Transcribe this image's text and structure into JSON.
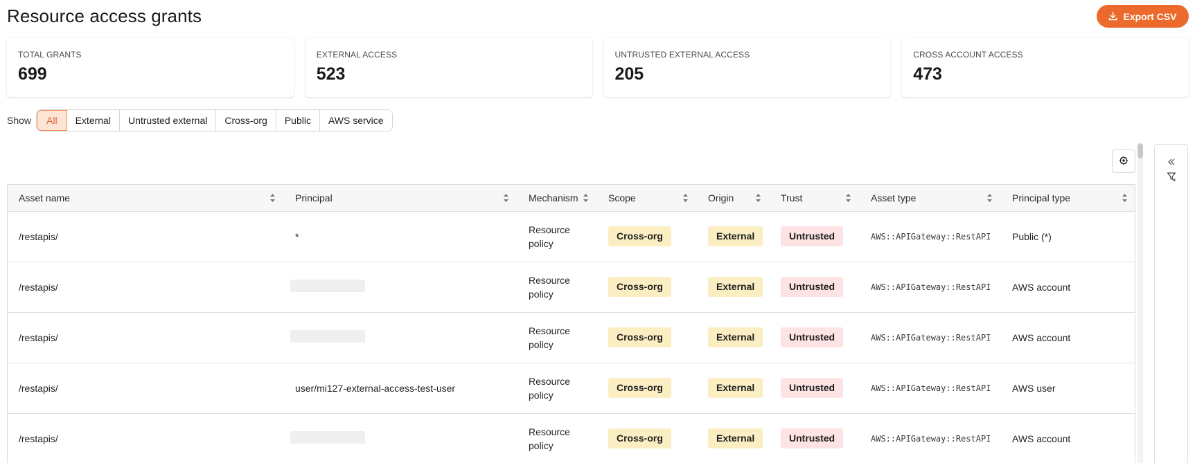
{
  "page": {
    "title": "Resource access grants",
    "export_label": "Export CSV"
  },
  "stats": [
    {
      "label": "TOTAL GRANTS",
      "value": "699"
    },
    {
      "label": "EXTERNAL ACCESS",
      "value": "523"
    },
    {
      "label": "UNTRUSTED EXTERNAL ACCESS",
      "value": "205"
    },
    {
      "label": "CROSS ACCOUNT ACCESS",
      "value": "473"
    }
  ],
  "filter": {
    "label": "Show",
    "options": [
      "All",
      "External",
      "Untrusted external",
      "Cross-org",
      "Public",
      "AWS service"
    ],
    "selected": "All"
  },
  "table": {
    "columns": [
      "Asset name",
      "Principal",
      "Mechanism",
      "Scope",
      "Origin",
      "Trust",
      "Asset type",
      "Principal type"
    ],
    "rows": [
      {
        "asset": "/restapis/",
        "principal": "*",
        "mechanism_line1": "Resource",
        "mechanism_line2": "policy",
        "scope": "Cross-org",
        "origin": "External",
        "trust": "Untrusted",
        "asset_type": "AWS::APIGateway::RestAPI",
        "principal_type": "Public (*)"
      },
      {
        "asset": "/restapis/",
        "principal": "",
        "mechanism_line1": "Resource",
        "mechanism_line2": "policy",
        "scope": "Cross-org",
        "origin": "External",
        "trust": "Untrusted",
        "asset_type": "AWS::APIGateway::RestAPI",
        "principal_type": "AWS account"
      },
      {
        "asset": "/restapis/",
        "principal": "",
        "mechanism_line1": "Resource",
        "mechanism_line2": "policy",
        "scope": "Cross-org",
        "origin": "External",
        "trust": "Untrusted",
        "asset_type": "AWS::APIGateway::RestAPI",
        "principal_type": "AWS account"
      },
      {
        "asset": "/restapis/",
        "principal": "user/mi127-external-access-test-user",
        "mechanism_line1": "Resource",
        "mechanism_line2": "policy",
        "scope": "Cross-org",
        "origin": "External",
        "trust": "Untrusted",
        "asset_type": "AWS::APIGateway::RestAPI",
        "principal_type": "AWS user"
      },
      {
        "asset": "/restapis/",
        "principal": "",
        "mechanism_line1": "Resource",
        "mechanism_line2": "policy",
        "scope": "Cross-org",
        "origin": "External",
        "trust": "Untrusted",
        "asset_type": "AWS::APIGateway::RestAPI",
        "principal_type": "AWS account"
      }
    ]
  },
  "icons": {
    "export": "download-icon",
    "settings": "settings-icon",
    "collapse": "double-chevron-left-icon",
    "filter": "filter-icon",
    "sort": "sort-icon"
  },
  "colors": {
    "accent": "#ec6a2c",
    "scope_pill": "#fbeec3",
    "origin_pill": "#fbeec3",
    "trust_pill": "#fde3e3",
    "active_filter_bg": "#fde5d6"
  }
}
